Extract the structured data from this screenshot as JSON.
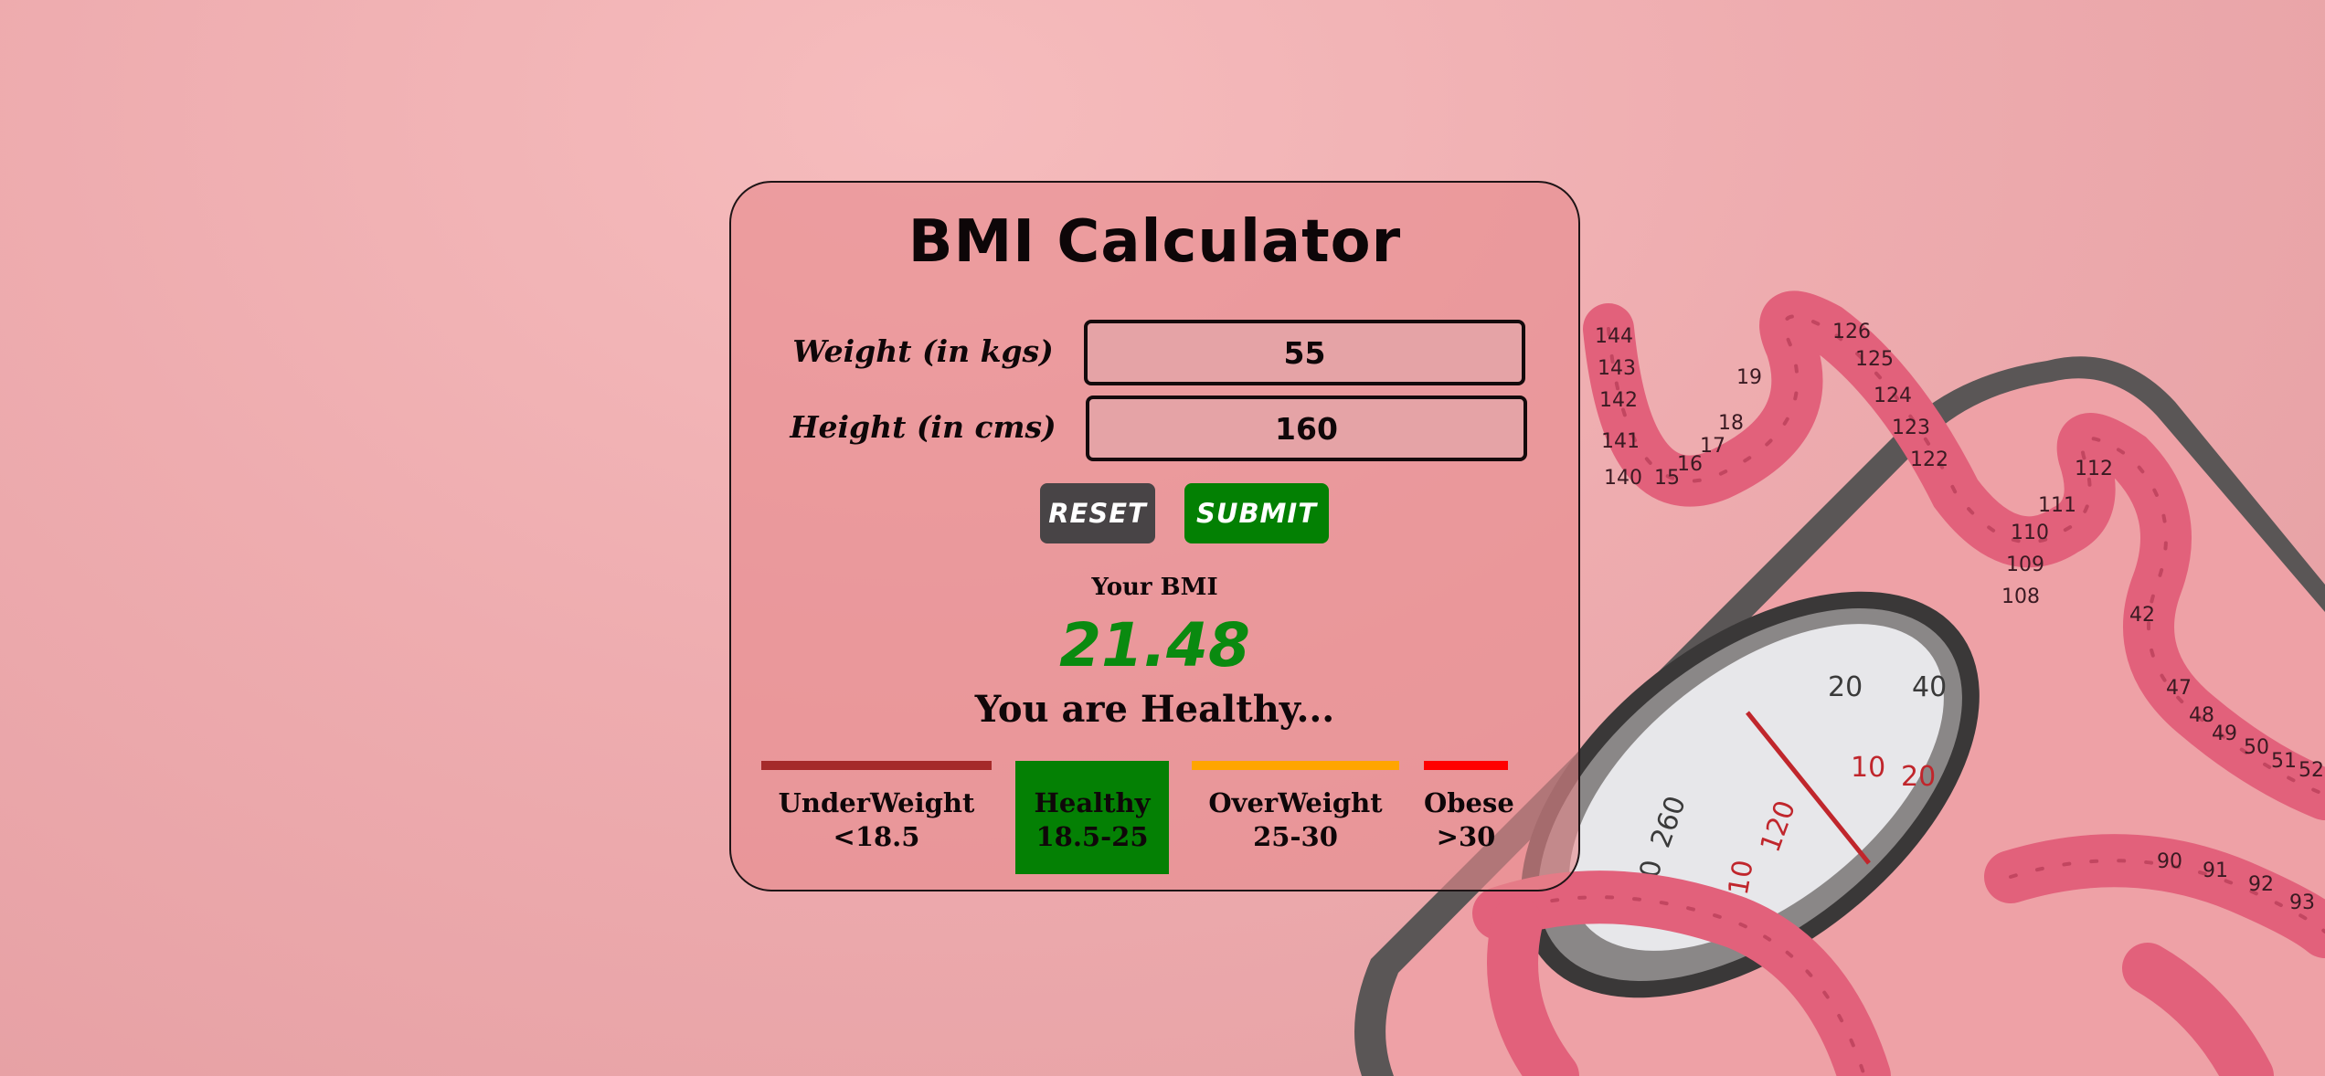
{
  "app": {
    "title": "BMI Calculator"
  },
  "form": {
    "weight": {
      "label": "Weight (in kgs)",
      "value": "55"
    },
    "height": {
      "label": "Height (in cms)",
      "value": "160"
    },
    "reset_label": "RESET",
    "submit_label": "SUBMIT"
  },
  "result": {
    "label": "Your BMI",
    "value": "21.48",
    "message": "You are Healthy..."
  },
  "categories": [
    {
      "name": "UnderWeight",
      "range": "<18.5",
      "color": "#a52a2a",
      "active": false
    },
    {
      "name": "Healthy",
      "range": "18.5-25",
      "color": "#048004",
      "active": true
    },
    {
      "name": "OverWeight",
      "range": "25-30",
      "color": "#ffa500",
      "active": false
    },
    {
      "name": "Obese",
      "range": ">30",
      "color": "#ff0000",
      "active": false
    }
  ],
  "colors": {
    "submit": "#038003",
    "reset": "#484446",
    "bmi_value": "#0a8a10"
  },
  "background": {
    "scale_dial_labels": [
      "20",
      "40",
      "10",
      "20",
      "260",
      "240",
      "120",
      "110"
    ],
    "tape_labels": [
      "144",
      "142",
      "141",
      "140",
      "143",
      "19",
      "18",
      "17",
      "16",
      "15",
      "126",
      "125",
      "124",
      "123",
      "122",
      "112",
      "111",
      "110",
      "109",
      "108",
      "42",
      "47",
      "48",
      "49",
      "50",
      "51",
      "52",
      "90",
      "91",
      "92",
      "93"
    ]
  }
}
